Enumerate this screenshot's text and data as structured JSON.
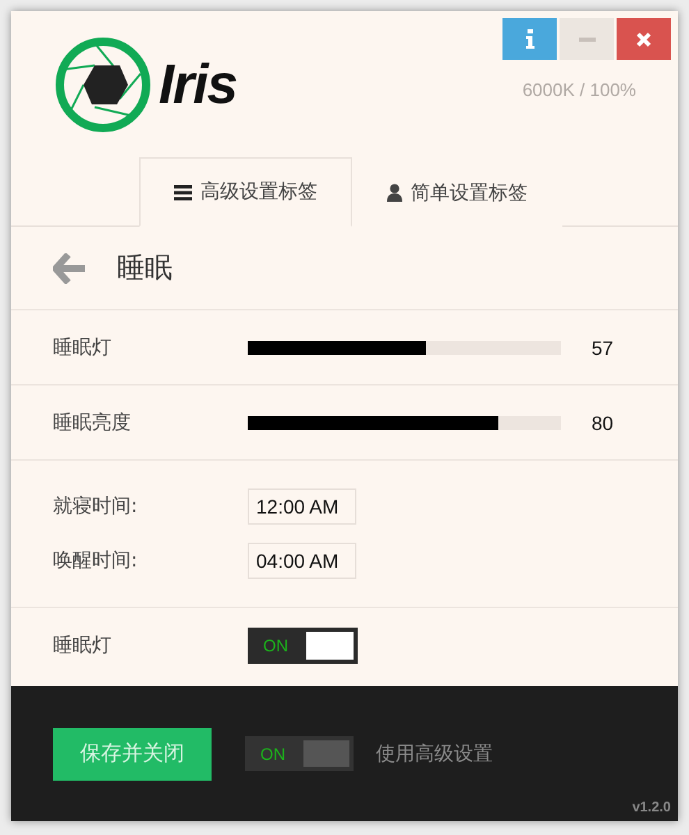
{
  "app": {
    "name": "Iris",
    "status": "6000K / 100%"
  },
  "tabs": [
    {
      "label": "高级设置标签",
      "kind": "menu",
      "selected": true
    },
    {
      "label": "简单设置标签",
      "kind": "user",
      "selected": false
    }
  ],
  "section": {
    "title": "睡眠"
  },
  "sliders": [
    {
      "label": "睡眠灯",
      "level": 0.57,
      "reading": "57"
    },
    {
      "label": "睡眠亮度",
      "level": 0.8,
      "reading": "80"
    }
  ],
  "times": [
    {
      "label": "就寝时间:",
      "value": "12:00 AM"
    },
    {
      "label": "唤醒时间:",
      "value": "04:00 AM"
    }
  ],
  "toggle_row": {
    "label": "睡眠灯",
    "toggle_text": "ON",
    "on": true
  },
  "footer": {
    "save_button": "保存并关闭",
    "toggle_text": "ON",
    "on": true,
    "toggle_label": "使用高级设置",
    "version": "v1.2.0"
  }
}
